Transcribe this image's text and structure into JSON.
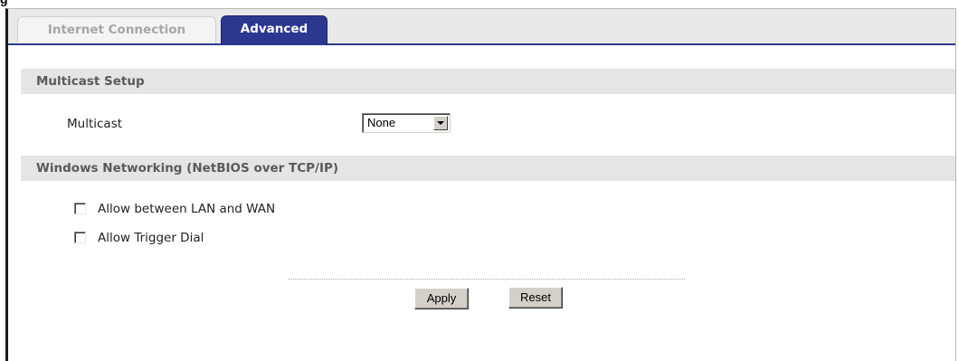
{
  "figure_caption": "g",
  "tabs": [
    {
      "label": "Internet Connection",
      "active": false
    },
    {
      "label": "Advanced",
      "active": true
    }
  ],
  "multicast_setup": {
    "header": "Multicast Setup",
    "multicast_label": "Multicast",
    "multicast_selected": "None"
  },
  "windows_networking": {
    "header": "Windows Networking (NetBIOS over TCP/IP)",
    "options": [
      {
        "label": "Allow between LAN and WAN",
        "checked": false
      },
      {
        "label": "Allow Trigger Dial",
        "checked": false
      }
    ]
  },
  "buttons": {
    "apply_label": "Apply",
    "reset_label": "Reset"
  },
  "colors": {
    "active_tab": "#2c3790",
    "section_header_bg": "#e5e5e5",
    "section_header_text": "#5a5a5a"
  }
}
